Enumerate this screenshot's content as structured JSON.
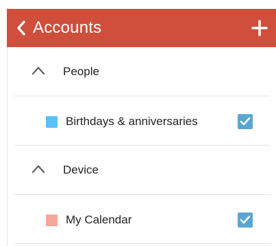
{
  "app_bar": {
    "title": "Accounts",
    "back_icon": "chevron-left-icon",
    "add_icon": "plus-icon",
    "color": "#cf4e3c"
  },
  "groups": [
    {
      "label": "People",
      "expanded": true,
      "calendars": [
        {
          "label": "Birthdays & anniversaries",
          "color": "#5bc0f3",
          "checked": true
        }
      ]
    },
    {
      "label": "Device",
      "expanded": true,
      "calendars": [
        {
          "label": "My Calendar",
          "color": "#f6a59a",
          "checked": true
        }
      ]
    }
  ]
}
